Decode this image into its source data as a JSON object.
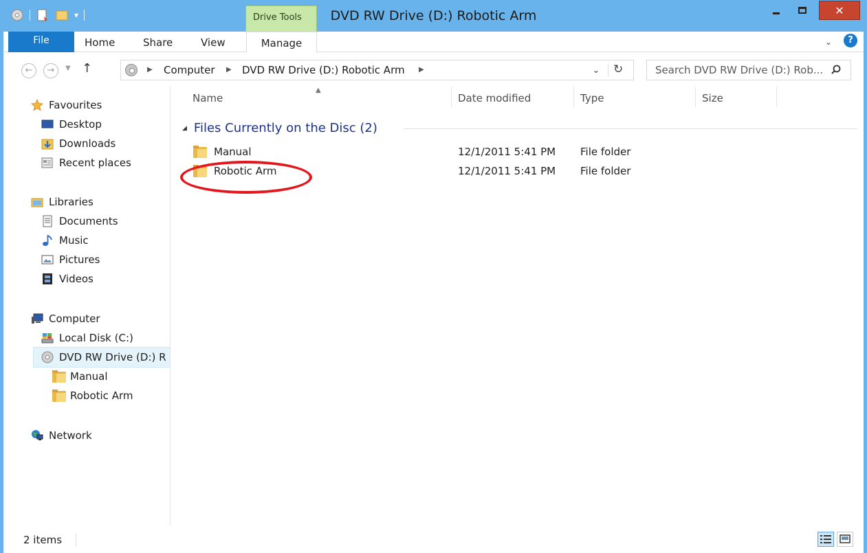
{
  "window": {
    "title": "DVD RW Drive (D:) Robotic Arm",
    "close_glyph": "✕",
    "context_tab_group": "Drive Tools"
  },
  "ribbon": {
    "tabs": [
      "File",
      "Home",
      "Share",
      "View",
      "Manage"
    ],
    "expand_glyph": "⌄",
    "help_glyph": "?"
  },
  "address": {
    "breadcrumbs": [
      "Computer",
      "DVD RW Drive (D:) Robotic Arm"
    ],
    "search_placeholder": "Search DVD RW Drive (D:) Rob..."
  },
  "nav_pane": {
    "favourites": {
      "label": "Favourites",
      "items": [
        "Desktop",
        "Downloads",
        "Recent places"
      ]
    },
    "libraries": {
      "label": "Libraries",
      "items": [
        "Documents",
        "Music",
        "Pictures",
        "Videos"
      ]
    },
    "computer": {
      "label": "Computer",
      "items": [
        "Local Disk (C:)",
        "DVD RW Drive (D:) R"
      ],
      "sub_items": [
        "Manual",
        "Robotic Arm"
      ]
    },
    "network": {
      "label": "Network"
    }
  },
  "content": {
    "columns": [
      "Name",
      "Date modified",
      "Type",
      "Size"
    ],
    "group_label": "Files Currently on the Disc (2)",
    "rows": [
      {
        "name": "Manual",
        "date": "12/1/2011 5:41 PM",
        "type": "File folder",
        "size": ""
      },
      {
        "name": "Robotic Arm",
        "date": "12/1/2011 5:41 PM",
        "type": "File folder",
        "size": ""
      }
    ],
    "highlighted_row": "Robotic Arm"
  },
  "status": {
    "item_count": "2 items"
  },
  "colors": {
    "titlebar": "#69b3ed",
    "file_tab": "#1979ca",
    "context_tab": "#c8e8a9",
    "group_header": "#1e3287",
    "annotation_ring": "#e3161d"
  }
}
